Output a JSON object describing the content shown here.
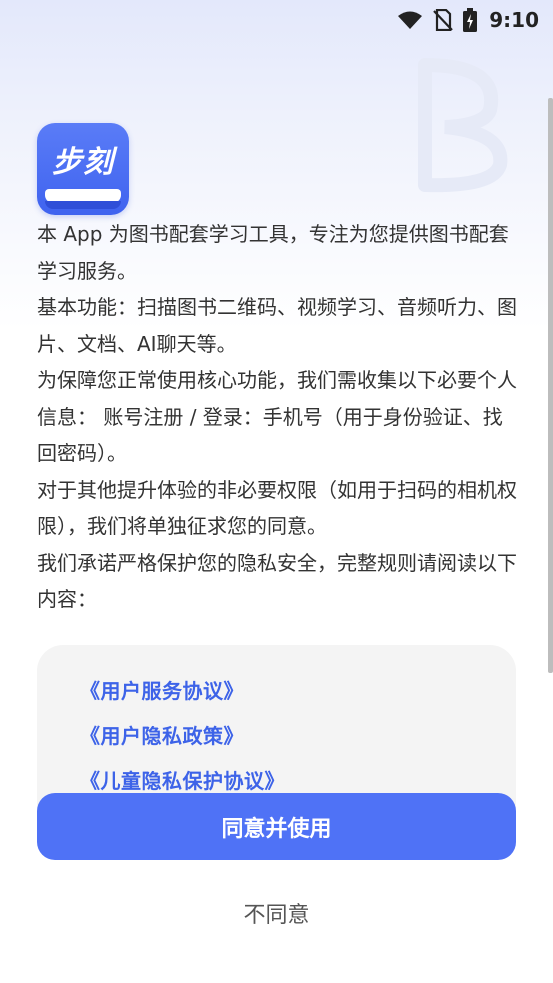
{
  "status_bar": {
    "time": "9:10",
    "icons": [
      "wifi-icon",
      "no-sim-icon",
      "battery-charging-icon"
    ]
  },
  "app": {
    "logo_text": "步刻"
  },
  "intro": {
    "paragraphs": [
      "本 App 为图书配套学习工具，专注为您提供图书配套学习服务。",
      "基本功能：扫描图书二维码、视频学习、音频听力、图片、文档、AI聊天等。",
      "为保障您正常使用核心功能，我们需收集以下必要个人信息： 账号注册 / 登录：手机号（用于身份验证、找回密码）。",
      "对于其他提升体验的非必要权限（如用于扫码的相机权限），我们将单独征求您的同意。",
      "我们承诺严格保护您的隐私安全，完整规则请阅读以下内容："
    ]
  },
  "links": [
    "《用户服务协议》",
    "《用户隐私政策》",
    "《儿童隐私保护协议》"
  ],
  "buttons": {
    "agree": "同意并使用",
    "disagree": "不同意"
  },
  "colors": {
    "accent": "#4f72f6",
    "link": "#3d63e8",
    "card": "#f4f4f4",
    "text": "#333333"
  }
}
